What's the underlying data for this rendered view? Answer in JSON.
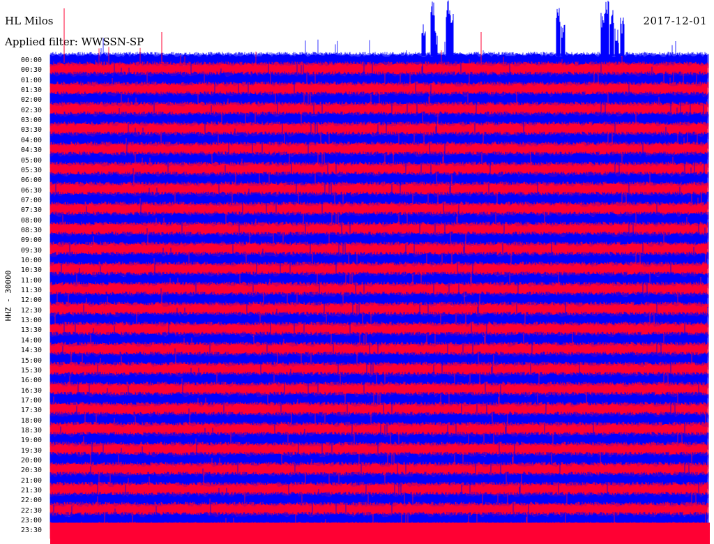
{
  "header": {
    "station": "HL Milos",
    "filter": "Applied filter: WWSSN-SP",
    "date": "2017-12-01"
  },
  "chart_data": {
    "type": "line",
    "title": "HL Milos",
    "subtitle": "Applied filter: WWSSN-SP",
    "ylabel": "HHZ - 30000",
    "xlabel": "",
    "date": "2017-12-01",
    "row_labels": [
      "00:00",
      "00:30",
      "01:00",
      "01:30",
      "02:00",
      "02:30",
      "03:00",
      "03:30",
      "04:00",
      "04:30",
      "05:00",
      "05:30",
      "06:00",
      "06:30",
      "07:00",
      "07:30",
      "08:00",
      "08:30",
      "09:00",
      "09:30",
      "10:00",
      "10:30",
      "11:00",
      "11:30",
      "12:00",
      "12:30",
      "13:00",
      "13:30",
      "14:00",
      "14:30",
      "15:00",
      "15:30",
      "16:00",
      "16:30",
      "17:00",
      "17:30",
      "18:00",
      "18:30",
      "19:00",
      "19:30",
      "20:00",
      "20:30",
      "21:00",
      "21:30",
      "22:00",
      "22:30",
      "23:00",
      "23:30"
    ],
    "series_colors": [
      "#0000ff",
      "#ff0033"
    ],
    "color_order": "alternating rows starting with blue at 00:00",
    "minutes_per_row": 30,
    "grid": false,
    "legend": "none"
  }
}
